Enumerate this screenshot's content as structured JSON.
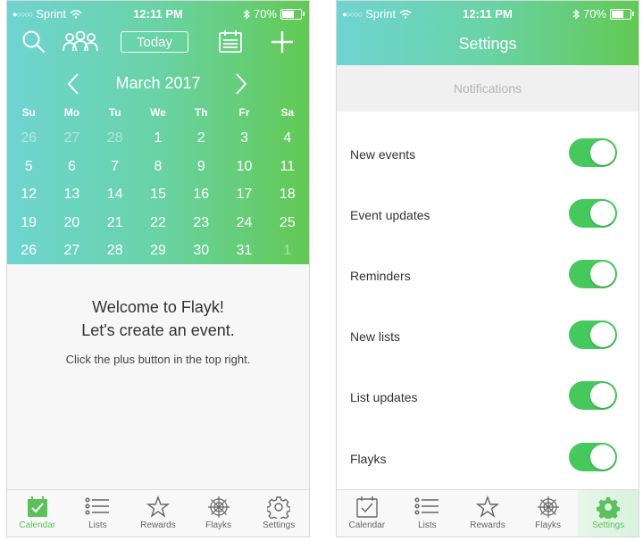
{
  "status_bar": {
    "carrier": "Sprint",
    "time": "12:11 PM",
    "battery": "70%",
    "battery_level": 0.7
  },
  "calendar_screen": {
    "today_label": "Today",
    "month_title": "March 2017",
    "weekdays": [
      "Su",
      "Mo",
      "Tu",
      "We",
      "Th",
      "Fr",
      "Sa"
    ],
    "weeks": [
      [
        {
          "d": "26",
          "dim": true
        },
        {
          "d": "27",
          "dim": true
        },
        {
          "d": "28",
          "dim": true
        },
        {
          "d": "1"
        },
        {
          "d": "2"
        },
        {
          "d": "3"
        },
        {
          "d": "4"
        }
      ],
      [
        {
          "d": "5"
        },
        {
          "d": "6"
        },
        {
          "d": "7"
        },
        {
          "d": "8"
        },
        {
          "d": "9"
        },
        {
          "d": "10"
        },
        {
          "d": "11"
        }
      ],
      [
        {
          "d": "12"
        },
        {
          "d": "13"
        },
        {
          "d": "14"
        },
        {
          "d": "15"
        },
        {
          "d": "16"
        },
        {
          "d": "17"
        },
        {
          "d": "18"
        }
      ],
      [
        {
          "d": "19"
        },
        {
          "d": "20"
        },
        {
          "d": "21"
        },
        {
          "d": "22"
        },
        {
          "d": "23"
        },
        {
          "d": "24"
        },
        {
          "d": "25"
        }
      ],
      [
        {
          "d": "26"
        },
        {
          "d": "27"
        },
        {
          "d": "28"
        },
        {
          "d": "29"
        },
        {
          "d": "30"
        },
        {
          "d": "31"
        },
        {
          "d": "1",
          "dim": true
        }
      ]
    ],
    "welcome_line1": "Welcome to Flayk!",
    "welcome_line2": "Let's create an event.",
    "hint": "Click the plus button in the top right."
  },
  "settings_screen": {
    "title": "Settings",
    "section": "Notifications",
    "rows": [
      {
        "label": "New events",
        "on": true
      },
      {
        "label": "Event updates",
        "on": true
      },
      {
        "label": "Reminders",
        "on": true
      },
      {
        "label": "New lists",
        "on": true
      },
      {
        "label": "List updates",
        "on": true
      },
      {
        "label": "Flayks",
        "on": true
      }
    ]
  },
  "tabs": [
    "Calendar",
    "Lists",
    "Rewards",
    "Flayks",
    "Settings"
  ],
  "colors": {
    "accent": "#5bc15a",
    "toggle_on": "#45c95d"
  },
  "icons": {
    "toolbar": [
      "search-icon",
      "people-icon",
      "calendar-list-icon",
      "plus-icon"
    ],
    "tabs": [
      "calendar-check-icon",
      "list-icon",
      "star-icon",
      "flayk-icon",
      "gear-icon"
    ]
  }
}
